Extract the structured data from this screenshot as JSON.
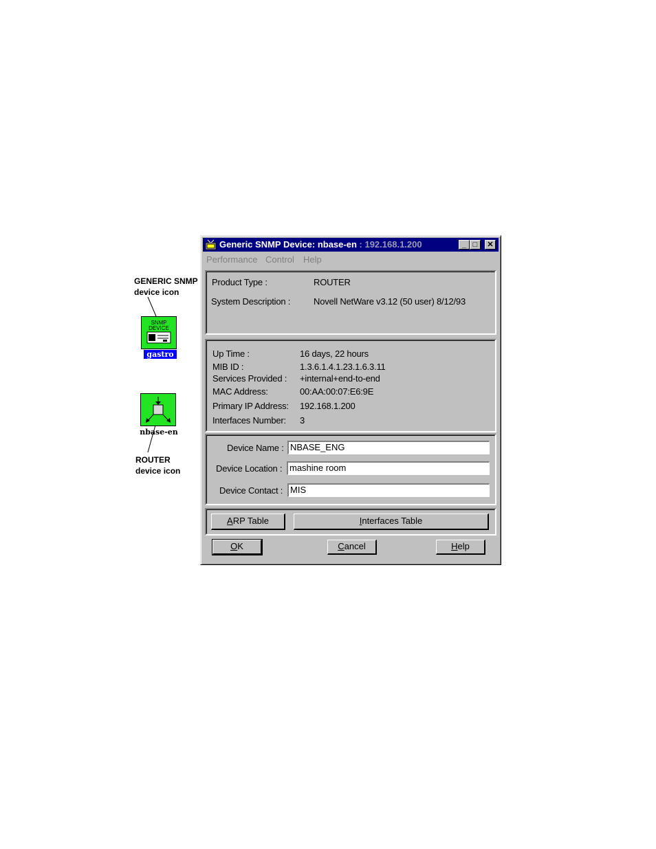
{
  "callouts": {
    "snmp_line1": "GENERIC SNMP",
    "snmp_line2": "device icon",
    "router_line1": "ROUTER",
    "router_line2": "device icon"
  },
  "icons": {
    "snmp_icon_text": "SNMP DEVICE",
    "snmp_icon_label": "gastro",
    "router_icon_label": "nbase-en"
  },
  "window": {
    "title_main": "Generic SNMP Device: nbase-en",
    "title_dim": " : 192.168.1.200",
    "menu": [
      "Performance",
      "Control",
      "Help"
    ]
  },
  "product": {
    "type_label": "Product Type :",
    "type_value": "ROUTER",
    "desc_label": "System Description :",
    "desc_value": "Novell NetWare v3.12 (50 user)  8/12/93"
  },
  "info": {
    "rows": [
      {
        "label": "Up Time :",
        "value": "16 days, 22 hours"
      },
      {
        "label": "MIB ID :",
        "value": "1.3.6.1.4.1.23.1.6.3.11"
      },
      {
        "label": "Services Provided :",
        "value": "+internal+end-to-end"
      },
      {
        "label": "MAC Address:",
        "value": "00:AA:00:07:E6:9E"
      },
      {
        "label": "Primary IP Address:",
        "value": "192.168.1.200"
      },
      {
        "label": "Interfaces Number:",
        "value": "3"
      }
    ]
  },
  "device": {
    "name_label": "Device Name :",
    "name_value": "NBASE_ENG",
    "location_label": "Device Location :",
    "location_value": "mashine room",
    "contact_label": "Device Contact :",
    "contact_value": "MIS"
  },
  "buttons": {
    "arp_pre": "",
    "arp_ul": "A",
    "arp_post": "RP Table",
    "iface_pre": "",
    "iface_ul": "I",
    "iface_post": "nterfaces Table",
    "ok_ul": "O",
    "ok_post": "K",
    "cancel_ul": "C",
    "cancel_post": "ancel",
    "help_ul": "H",
    "help_post": "elp"
  },
  "colors": {
    "title_bar": "#000080",
    "dialog_face": "#c0c0c0",
    "icon_green": "#22e422",
    "label_highlight": "#0000ff"
  }
}
